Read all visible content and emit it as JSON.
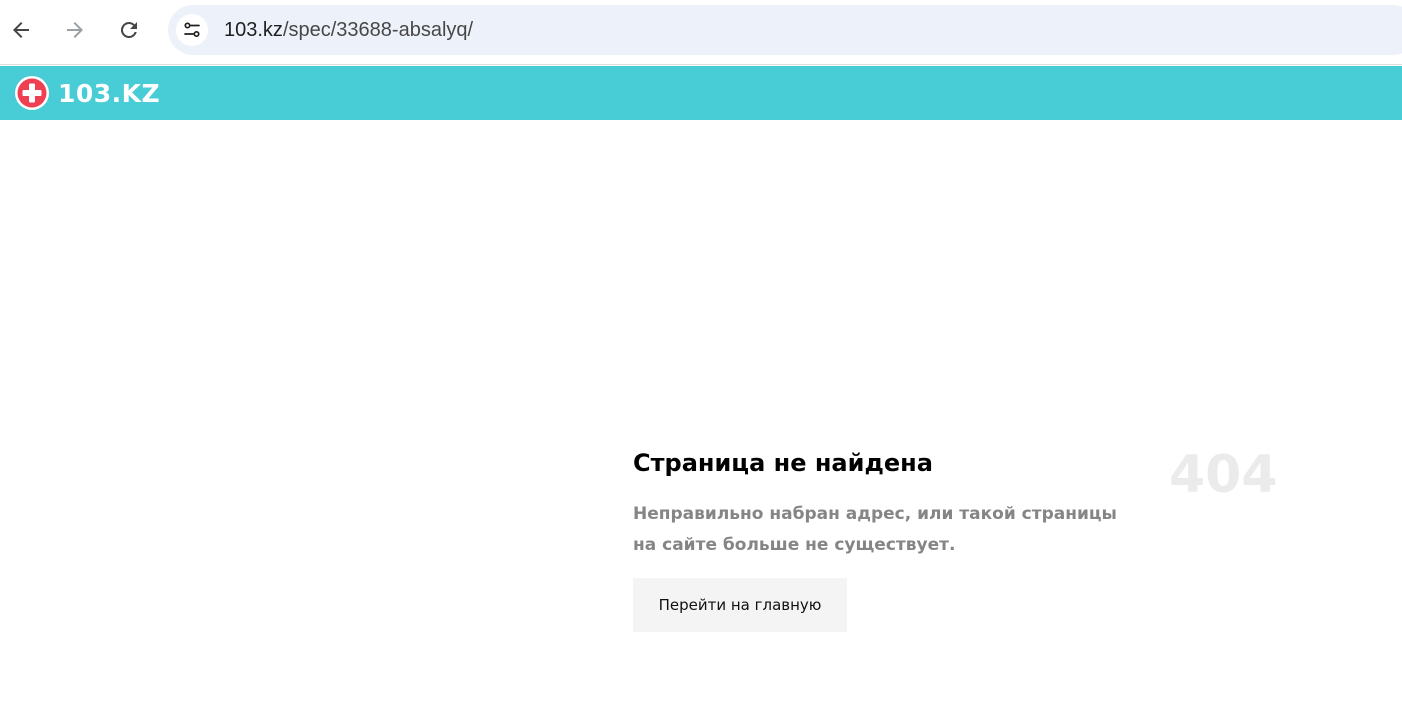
{
  "browser": {
    "url_host": "103.kz",
    "url_path": "/spec/33688-absalyq/",
    "icons": {
      "back": "arrow-left-icon",
      "forward": "arrow-right-icon",
      "reload": "reload-icon",
      "site_info": "tune-icon"
    }
  },
  "site": {
    "logo_text": "103.KZ",
    "header_color": "#48cdd7",
    "logo_accent_color": "#ef3f52"
  },
  "error": {
    "title": "Страница не найдена",
    "code": "404",
    "description": "Неправильно набран адрес, или такой страницы на сайте больше не существует.",
    "button_label": "Перейти на главную"
  }
}
